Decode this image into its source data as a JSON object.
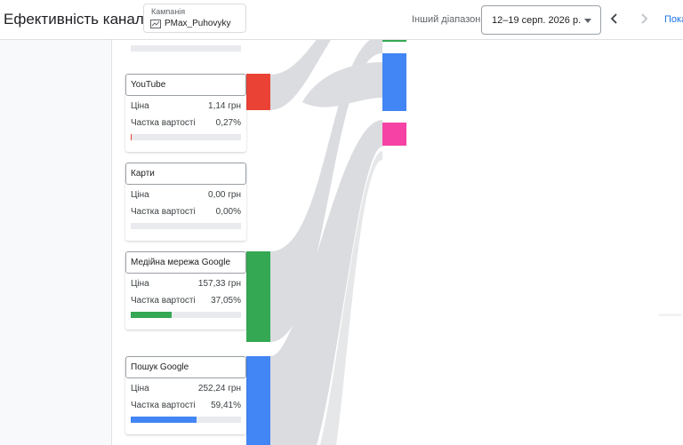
{
  "header": {
    "title": "Ефективність каналів",
    "campaign_label": "Кампанія",
    "campaign_value": "PMax_Puhovyky",
    "other_range": "Інший діапазон",
    "date_range": "12–19 серп. 2026 р.",
    "show_label": "Пока"
  },
  "row_labels": {
    "price": "Ціна",
    "share": "Частка вартості"
  },
  "channels": [
    {
      "name": "YouTube",
      "price": "1,14 грн",
      "share": "0,27%",
      "share_value": 0.27,
      "color": "#ea4335"
    },
    {
      "name": "Карти",
      "price": "0,00 грн",
      "share": "0,00%",
      "share_value": 0.0,
      "color": "#fbbc04"
    },
    {
      "name": "Медійна мережа Google",
      "price": "157,33 грн",
      "share": "37,05%",
      "share_value": 37.05,
      "color": "#34a853"
    },
    {
      "name": "Пошук Google",
      "price": "252,24 грн",
      "share": "59,41%",
      "share_value": 59.41,
      "color": "#4285f4"
    }
  ],
  "colors": {
    "flow": "#dadce0",
    "bar_bg": "#e8eaed",
    "accent": "#1a73e8",
    "pink": "#f542a4"
  }
}
